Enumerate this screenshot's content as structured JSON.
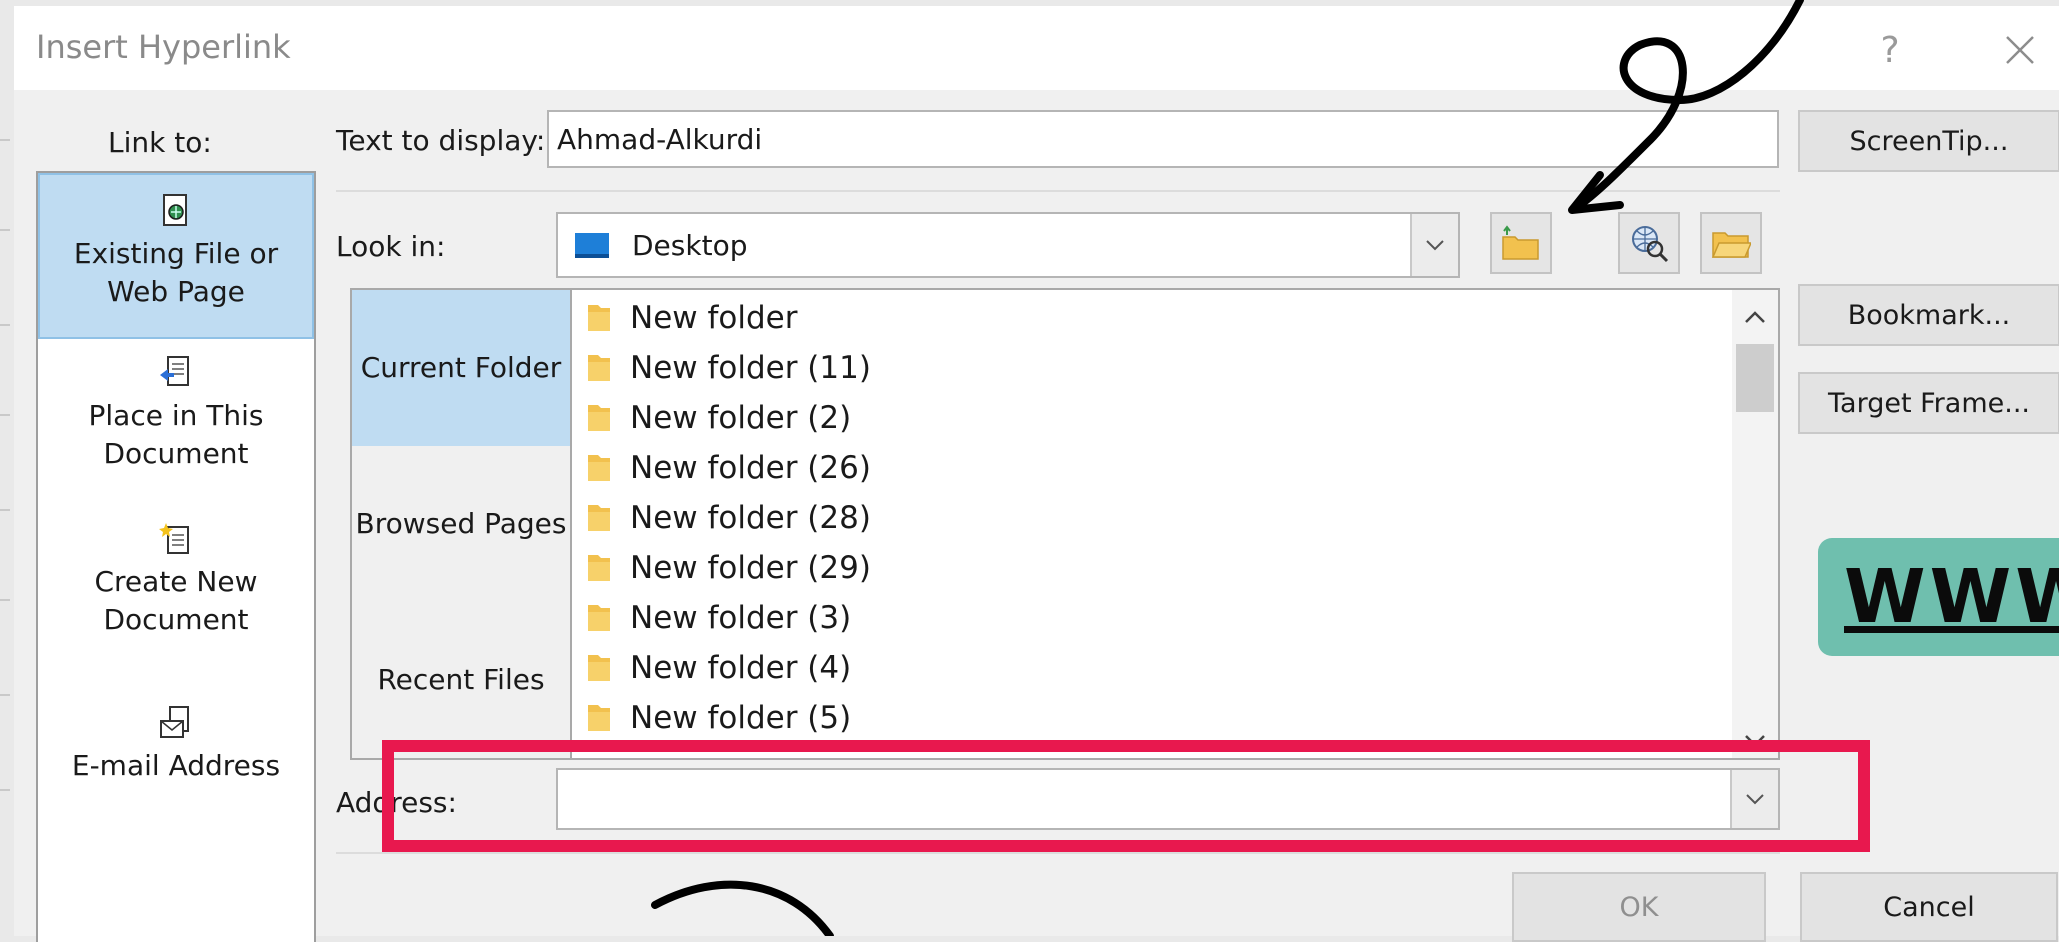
{
  "dialog": {
    "title": "Insert Hyperlink",
    "help": "?",
    "close": "✕"
  },
  "link_to": {
    "label": "Link to:",
    "items": [
      {
        "line1": "Existing File or",
        "line2": "Web Page",
        "selected": true
      },
      {
        "line1": "Place in This",
        "line2": "Document",
        "selected": false
      },
      {
        "line1": "Create New",
        "line2": "Document",
        "selected": false
      },
      {
        "line1": "E-mail Address",
        "line2": "",
        "selected": false
      }
    ]
  },
  "text_to_display": {
    "label": "Text to display:",
    "value": "Ahmad-Alkurdi"
  },
  "look_in": {
    "label": "Look in:",
    "value": "Desktop"
  },
  "browse_tabs": [
    "Current Folder",
    "Browsed Pages",
    "Recent Files"
  ],
  "files": [
    "New folder",
    "New folder (11)",
    "New folder (2)",
    "New folder (26)",
    "New folder (28)",
    "New folder (29)",
    "New folder (3)",
    "New folder (4)",
    "New folder (5)"
  ],
  "address": {
    "label": "Address:",
    "value": ""
  },
  "buttons": {
    "screentip": "ScreenTip...",
    "bookmark": "Bookmark...",
    "target_frame": "Target Frame...",
    "ok": "OK",
    "cancel": "Cancel"
  },
  "overlay": {
    "www_badge": "WWW",
    "highlight_color": "#e8184e",
    "badge_color": "#6fbfae"
  },
  "colors": {
    "selected_bg": "#bfdcf2",
    "folder": "#f2c14e"
  },
  "icons": {
    "up_folder": "up-one-folder-icon",
    "browse_web": "browse-web-icon",
    "browse_file": "browse-file-icon"
  }
}
